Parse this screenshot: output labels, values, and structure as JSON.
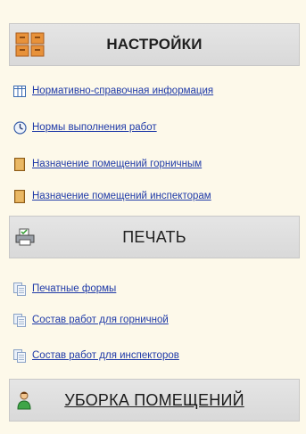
{
  "sections": {
    "settings": {
      "title": "НАСТРОЙКИ",
      "icon": "settings-cabinet-icon",
      "items": [
        {
          "label": "Нормативно-справочная информация",
          "icon": "table-icon"
        },
        {
          "label": "Нормы выполнения работ",
          "icon": "clock-icon"
        },
        {
          "label": "Назначение помещений горничным",
          "icon": "book-icon"
        },
        {
          "label": "Назначение помещений инспекторам",
          "icon": "book-icon"
        }
      ]
    },
    "print": {
      "title": "ПЕЧАТЬ",
      "icon": "printer-icon",
      "items": [
        {
          "label": "Печатные формы",
          "icon": "document-stack-icon"
        },
        {
          "label": "Состав работ для горничной",
          "icon": "document-stack-icon"
        },
        {
          "label": "Состав работ для инспекторов",
          "icon": "document-stack-icon"
        }
      ]
    },
    "cleaning": {
      "title": "УБОРКА ПОМЕЩЕНИЙ",
      "icon": "person-icon"
    }
  },
  "colors": {
    "background": "#fdf9ea",
    "header_bg": "#dedede",
    "link": "#1f3aa8"
  }
}
